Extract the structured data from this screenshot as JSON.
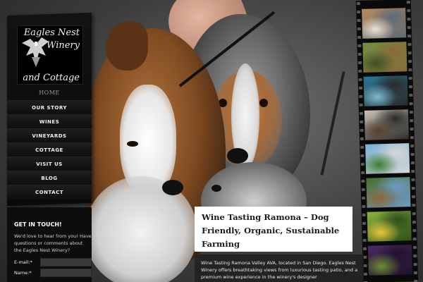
{
  "site": {
    "logo_lines": [
      "Eagles Nest",
      "Winery",
      "and Cottage"
    ]
  },
  "nav": {
    "home": "HOME",
    "items": [
      "OUR STORY",
      "WINES",
      "VINEYARDS",
      "COTTAGE",
      "VISIT US",
      "BLOG",
      "CONTACT"
    ]
  },
  "touch": {
    "title": "GET IN TOUCH!",
    "text": "We'd love to hear from you! Have questions or comments about the Eagles Nest Winery?",
    "email_label": "E-mail:*",
    "name_label": "Name:*"
  },
  "article": {
    "title": "Wine Tasting Ramona – Dog Friendly, Organic, Sustainable Farming",
    "body": "Wine Tasting Ramona Valley AVA, located in San Diego. Eagles Nest Winery offers breathtaking views from luxurious tasting patio, and a premium wine experience in the winery's designer"
  },
  "filmstrip": {
    "frames": [
      {
        "subject": "dogs-photo",
        "colors": [
          "#b88a5a",
          "#e9e1d4",
          "#5e6b78"
        ]
      },
      {
        "subject": "winery-sign-photo",
        "colors": [
          "#6f8f44",
          "#3c5322",
          "#8a6a3b"
        ]
      },
      {
        "subject": "people-photo",
        "colors": [
          "#2a7a9a",
          "#7fb9cf",
          "#2a2a2a"
        ]
      },
      {
        "subject": "vineyard-people-photo",
        "colors": [
          "#c9c4b8",
          "#56402c",
          "#2c2c2c"
        ]
      },
      {
        "subject": "patio-photo",
        "colors": [
          "#77b0d8",
          "#3f7d2f",
          "#d6d6d6"
        ]
      },
      {
        "subject": "horse-photo",
        "colors": [
          "#4a6d2a",
          "#8c6a3e",
          "#6f9bc4"
        ]
      },
      {
        "subject": "flower-photo",
        "colors": [
          "#8ab33e",
          "#e6c43a",
          "#2f4f1a"
        ]
      },
      {
        "subject": "grapes-photo",
        "colors": [
          "#4b2a5e",
          "#6b8d2e",
          "#21122c"
        ]
      }
    ]
  }
}
